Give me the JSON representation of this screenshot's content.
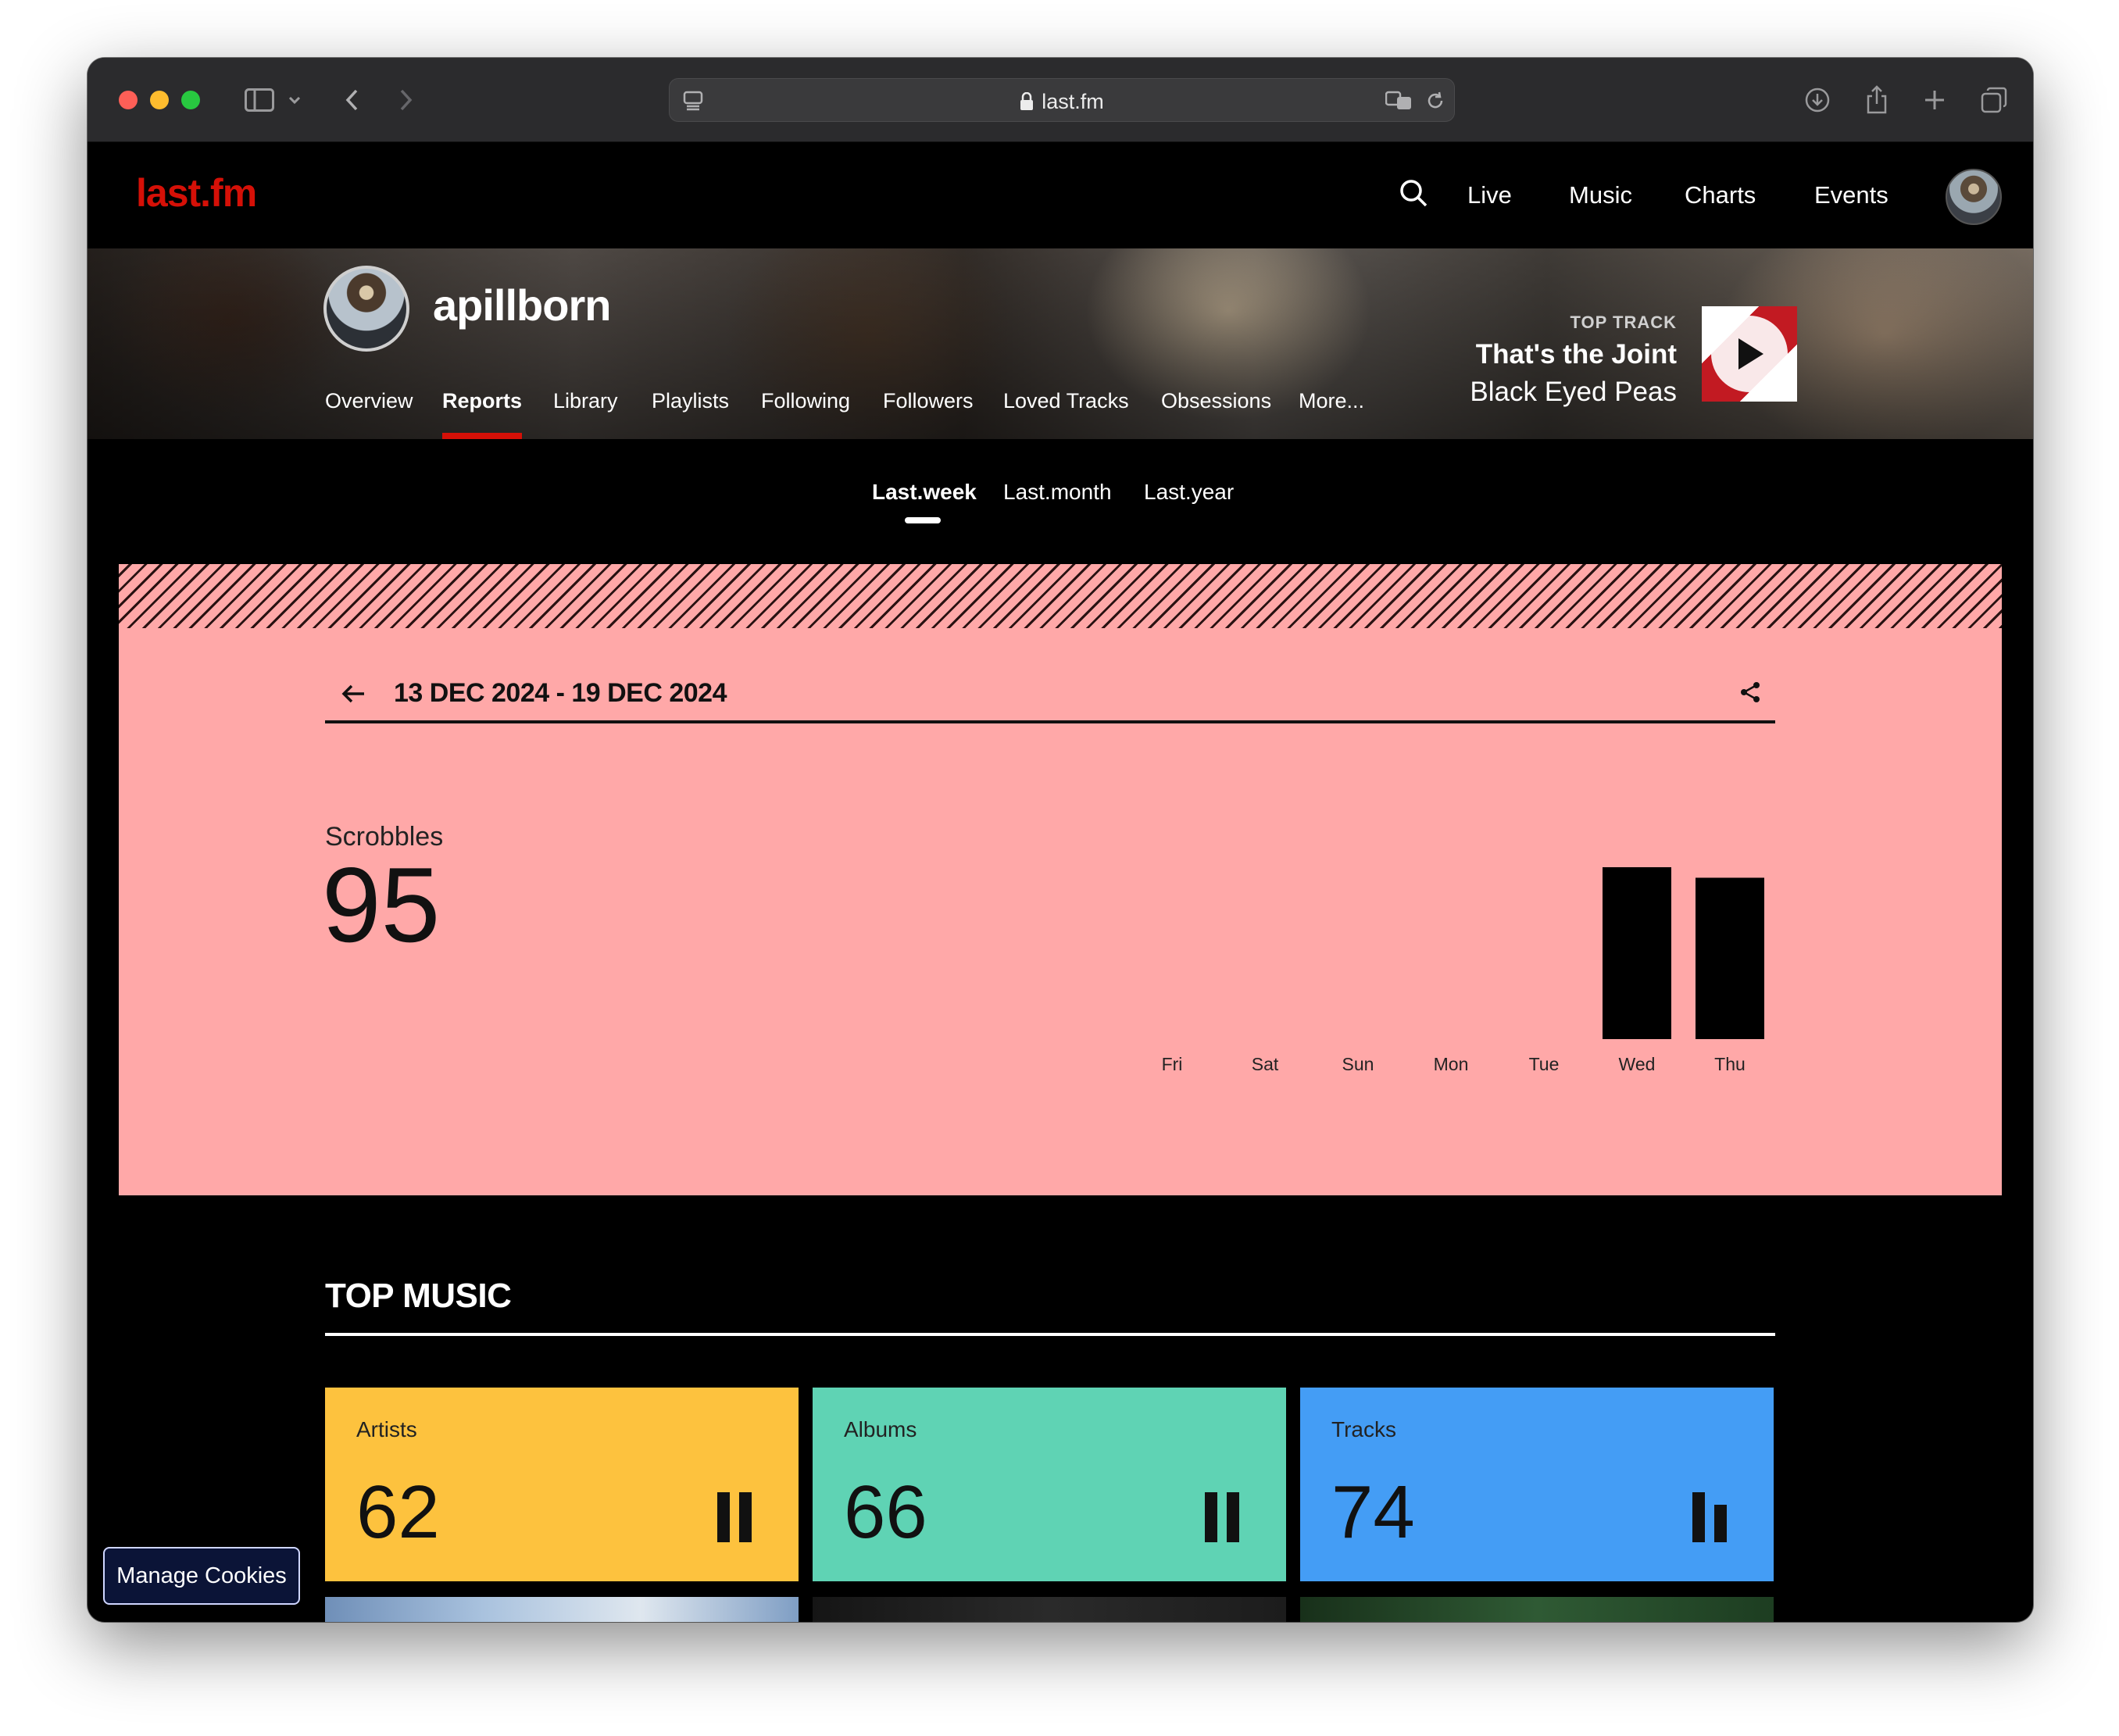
{
  "browser": {
    "url": "last.fm"
  },
  "site": {
    "logo": "last.fm",
    "nav": [
      {
        "label": "Live"
      },
      {
        "label": "Music"
      },
      {
        "label": "Charts"
      },
      {
        "label": "Events"
      }
    ]
  },
  "profile": {
    "username": "apillborn",
    "tabs": [
      {
        "label": "Overview"
      },
      {
        "label": "Reports"
      },
      {
        "label": "Library"
      },
      {
        "label": "Playlists"
      },
      {
        "label": "Following"
      },
      {
        "label": "Followers"
      },
      {
        "label": "Loved Tracks"
      },
      {
        "label": "Obsessions"
      },
      {
        "label": "More..."
      }
    ],
    "active_tab": "Reports",
    "top_track": {
      "kicker": "TOP TRACK",
      "title": "That's the Joint",
      "artist": "Black Eyed Peas"
    }
  },
  "periods": [
    {
      "label": "Last.week"
    },
    {
      "label": "Last.month"
    },
    {
      "label": "Last.year"
    }
  ],
  "active_period": "Last.week",
  "report": {
    "date_range": "13 DEC 2024 - 19 DEC 2024",
    "scrobbles_label": "Scrobbles",
    "scrobbles_value": "95",
    "panel_color": "#ffa8a8"
  },
  "chart_data": {
    "type": "bar",
    "categories": [
      "Fri",
      "Sat",
      "Sun",
      "Mon",
      "Tue",
      "Wed",
      "Thu"
    ],
    "values": [
      0,
      0,
      0,
      0,
      0,
      49,
      46
    ],
    "title": "",
    "xlabel": "",
    "ylabel": ""
  },
  "top_music": {
    "title": "TOP MUSIC",
    "cards": [
      {
        "label": "Artists",
        "value": "62",
        "color": "#fdc23e",
        "bars": [
          0.8,
          0.8
        ]
      },
      {
        "label": "Albums",
        "value": "66",
        "color": "#5fd3b4",
        "bars": [
          0.8,
          0.8
        ]
      },
      {
        "label": "Tracks",
        "value": "74",
        "color": "#449df5",
        "bars": [
          0.8,
          0.6
        ]
      }
    ]
  },
  "cookie_button": {
    "label": "Manage Cookies"
  },
  "colors": {
    "brand_red": "#d51007"
  }
}
